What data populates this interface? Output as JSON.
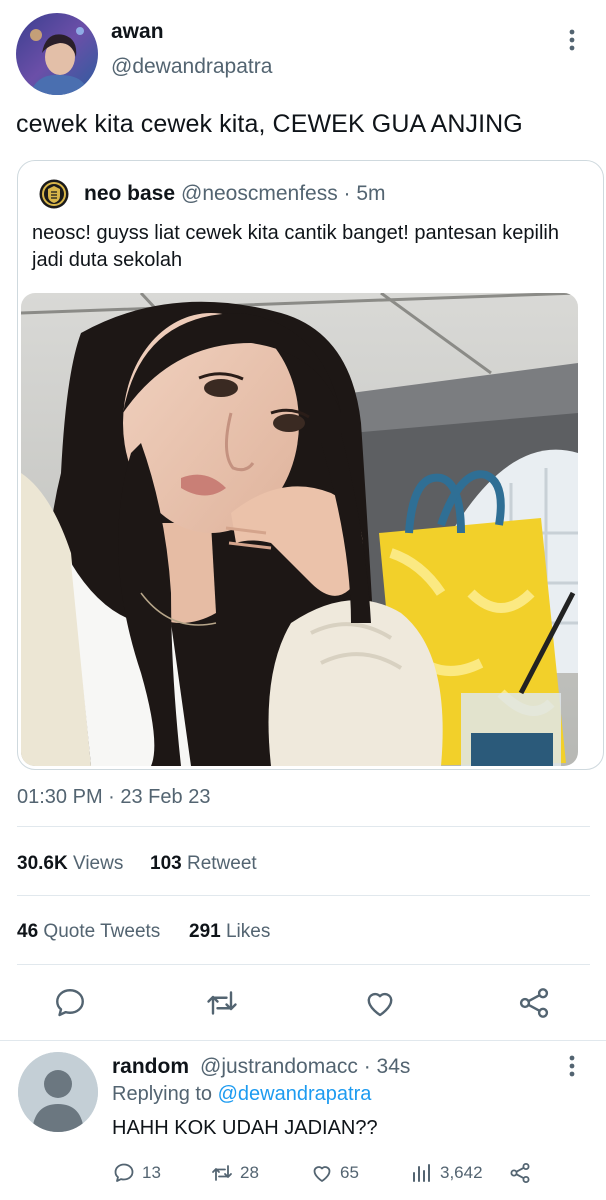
{
  "tweet": {
    "author": {
      "display_name": "awan",
      "handle": "@dewandrapatra"
    },
    "text": "cewek kita cewek kita, CEWEK GUA ANJING",
    "timestamp": "01:30 PM · 23 Feb 23",
    "stats": {
      "views_count": "30.6K",
      "views_label": "Views",
      "retweet_count": "103",
      "retweet_label": "Retweet",
      "quote_count": "46",
      "quote_label": "Quote Tweets",
      "likes_count": "291",
      "likes_label": "Likes"
    }
  },
  "quote": {
    "author_name": "neo base",
    "meta": "@neoscmenfess · 5m",
    "text": "neosc! guyss liat cewek kita cantik banget! pantesan kepilih jadi duta sekolah"
  },
  "reply": {
    "author_name": "random",
    "meta": "@justrandomacc · 34s",
    "replying_prefix": "Replying to",
    "replying_to": "@dewandrapatra",
    "text": "HAHH KOK UDAH JADIAN??",
    "counts": {
      "replies": "13",
      "retweets": "28",
      "likes": "65",
      "views": "3,642"
    }
  },
  "colors": {
    "text": "#0f1419",
    "secondary": "#536471",
    "accent": "#1d9bf0",
    "border": "#cfd9de"
  },
  "icons": [
    "more-icon",
    "reply-icon",
    "retweet-icon",
    "like-icon",
    "share-icon",
    "views-icon"
  ]
}
